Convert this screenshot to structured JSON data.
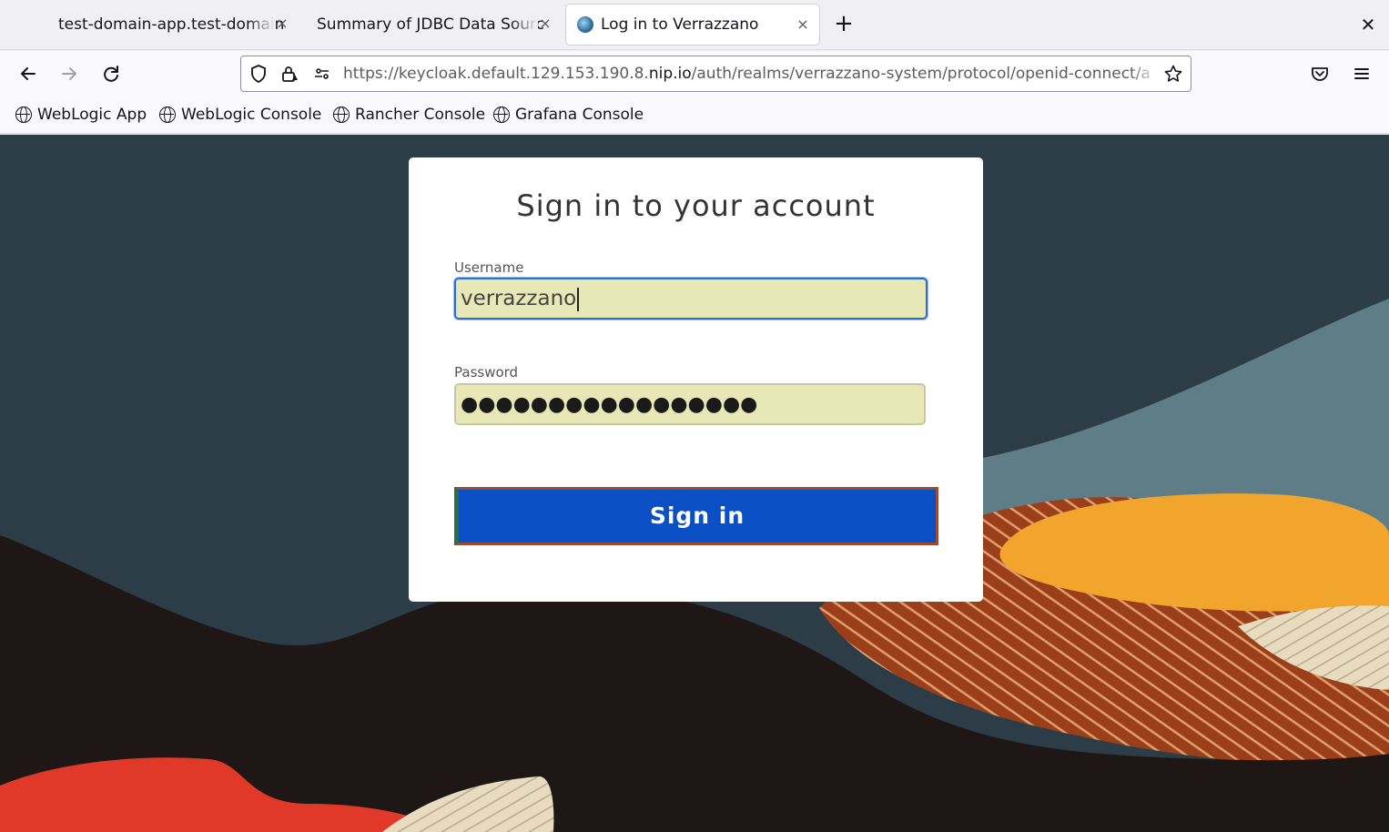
{
  "browser": {
    "tabs": [
      {
        "title": "test-domain-app.test-domain"
      },
      {
        "title": "Summary of JDBC Data Sourc"
      },
      {
        "title": "Log in to Verrazzano"
      }
    ],
    "tab_close_glyph": "×",
    "new_tab_glyph": "+",
    "window_close_glyph": "✕",
    "url": {
      "prefix": "https://keycloak.default.129.153.190.8.",
      "domain": "nip.io",
      "suffix": "/auth/realms/verrazzano-system/protocol/openid-connect/a"
    },
    "bookmarks": [
      {
        "label": "WebLogic App"
      },
      {
        "label": "WebLogic Console"
      },
      {
        "label": "Rancher Console"
      },
      {
        "label": "Grafana Console"
      }
    ]
  },
  "login": {
    "heading": "Sign in to your account",
    "username_label": "Username",
    "username_value": "verrazzano",
    "password_label": "Password",
    "password_mask": "●●●●●●●●●●●●●●●●●",
    "submit_label": "Sign in"
  },
  "colors": {
    "primary_button": "#0a4fc4",
    "autofill_bg": "#e8e8b6",
    "background_dark": "#2c3d47"
  }
}
